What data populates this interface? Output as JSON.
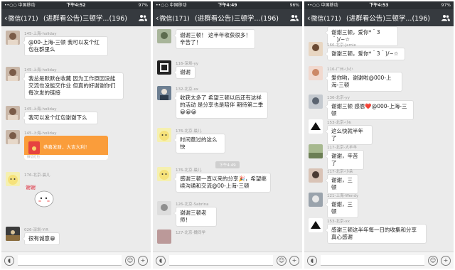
{
  "screens": [
    {
      "status": {
        "carrier": "••○○ 中国移动 ",
        "time": "下午4:52",
        "battery": "97%"
      },
      "nav": {
        "back": "微信(171)",
        "title": "(进群看公告)三顿学...(196)"
      },
      "messages": [
        {
          "sender": "145-上海-holiday",
          "text": "@00-上海-三顿 我可以发个红包在群里么"
        },
        {
          "sender": "145-上海-holiday",
          "text": "我总是默默在收藏 因为工作原因没能交流也没能交作业 但真的好谢谢你们每次发的链接"
        },
        {
          "sender": "145-上海-holiday",
          "text": "我可以发个红包谢谢下么"
        },
        {
          "sender": "145-上海-holiday",
          "red_packet": {
            "label": "恭喜发财，大吉大利！",
            "footer": "微信红包"
          }
        },
        {
          "sender": "176-北京-晨儿",
          "sticker_text": "谢谢"
        },
        {
          "sender": "026-深圳-Y-R",
          "text": "很有诚意😀"
        }
      ]
    },
    {
      "status": {
        "carrier": "••○○ 中国移动 ",
        "time": "下午4:49",
        "battery": "96%"
      },
      "nav": {
        "back": "微信(171)",
        "title": "(进群看公告)三顿学...(196)"
      },
      "messages": [
        {
          "sender": "",
          "text": "谢谢三顿！ 这半年收获很多！辛苦了！"
        },
        {
          "sender": "116-深圳-yy",
          "text": "谢谢"
        },
        {
          "sender": "132-北京-xx",
          "text": "收获太多了 希望三顿以后还有这样的活动 是分享也是陪伴 期待第二季😀😀😀"
        },
        {
          "sender": "176-北京-晨儿",
          "text": "时间竟过的这么快"
        },
        {
          "timestamp": "下午4:49"
        },
        {
          "sender": "176-北京-晨儿",
          "text": "感谢三顿一直以来的分享🎉，希望继续沟通和交流@00-上海-三顿"
        },
        {
          "sender": "126-北京-Sabrina",
          "text": "谢谢三顿老师！"
        },
        {
          "sender": "127-北京-魏同学",
          "text": ""
        }
      ]
    },
    {
      "status": {
        "carrier": "••○○ 中国移动 ",
        "time": "下午4:53",
        "battery": "97%"
      },
      "nav": {
        "back": "微信(171)",
        "title": "(进群看公告)三顿学...(196)"
      },
      "messages": [
        {
          "sender": "",
          "text": "谢谢三顿，爱你*＾3＾)/~☆"
        },
        {
          "sender": "166-北京-Jamie",
          "text": "谢谢三顿，爱你*＾3＾)/~☆"
        },
        {
          "sender": "116-广州-小小",
          "text": "爱你哟，谢谢啦@000-上海-三顿"
        },
        {
          "sender": "136-北京-yy",
          "text": "谢谢三顿 感恩❤️@000-上海-三顿"
        },
        {
          "sender": "153-北京-小k",
          "text": "这么快就半年了"
        },
        {
          "sender": "117-北京-大羊羊",
          "text": "谢谢，辛苦了"
        },
        {
          "sender": "117-北京-小朵",
          "text": "谢谢，三顿"
        },
        {
          "sender": "121-上海-Wendy",
          "text": "谢谢，三顿"
        },
        {
          "sender": "153-北京-xx",
          "text": "感谢三顿这半年每一日的收集和分享 真心感谢"
        }
      ]
    }
  ],
  "colors": {
    "status_bar": "#2b2f33",
    "nav_bar": "#363a3f",
    "chat_bg": "#ebebeb",
    "bubble": "#ffffff",
    "red_packet": "#fa9d3b"
  },
  "icons": {
    "nav_back": "chevron-left-icon",
    "nav_people": "group-members-icon",
    "input_voice": "voice-icon",
    "input_emoji": "emoji-icon",
    "input_plus": "plus-icon"
  }
}
